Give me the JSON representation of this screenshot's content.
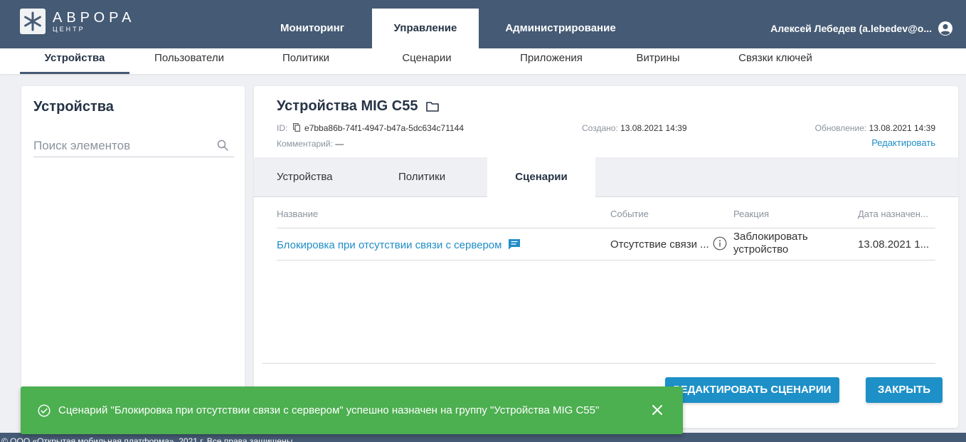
{
  "colors": {
    "topbar": "#455a74",
    "accent": "#1e90c8",
    "link": "#1f8dc8",
    "toast": "#4caf50"
  },
  "logo": {
    "title": "АВРОРА",
    "subtitle": "ЦЕНТР"
  },
  "nav": {
    "tabs": [
      "Мониторинг",
      "Управление",
      "Администрирование"
    ],
    "active": "Управление"
  },
  "user": {
    "name": "Алексей Лебедев (a.lebedev@o...",
    "icon": "user-circle-icon"
  },
  "subnav": {
    "items": [
      "Устройства",
      "Пользователи",
      "Политики",
      "Сценарии",
      "Приложения",
      "Витрины",
      "Связки ключей"
    ],
    "active": "Устройства"
  },
  "sidebar": {
    "title": "Устройства",
    "search_placeholder": "Поиск элементов",
    "search_icon": "search-icon"
  },
  "group": {
    "title": "Устройства MIG C55",
    "id_label": "ID:",
    "id_value": "e7bba86b-74f1-4947-b47a-5dc634c71144",
    "comment_label": "Комментарий:",
    "comment_value": "—",
    "created_label": "Создано:",
    "created_value": "13.08.2021 14:39",
    "updated_label": "Обновление:",
    "updated_value": "13.08.2021 14:39",
    "edit_link": "Редактировать"
  },
  "tabs": {
    "items": [
      "Устройства",
      "Политики",
      "Сценарии"
    ],
    "active": "Сценарии"
  },
  "table": {
    "columns": [
      "Название",
      "Событие",
      "Реакция",
      "Дата назначен..."
    ],
    "rows": [
      {
        "name": "Блокировка при отсутствии связи с сервером",
        "event": "Отсутствие связи ...",
        "reaction": "Заблокировать устройство",
        "date": "13.08.2021 1..."
      }
    ]
  },
  "buttons": {
    "edit": "РЕДАКТИРОВАТЬ СЦЕНАРИИ",
    "close": "ЗАКРЫТЬ"
  },
  "copyright": "© ООО «Открытая мобильная платформа», 2021 г. Все права защищены",
  "toast": {
    "message": "Сценарий \"Блокировка при отсутствии связи с сервером\" успешно назначен на группу \"Устройства MIG C55\""
  }
}
